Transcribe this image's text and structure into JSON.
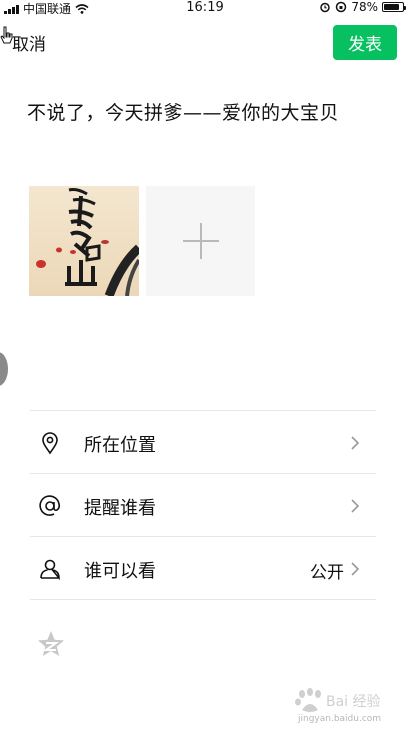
{
  "status_bar": {
    "carrier": "中国联通",
    "time": "16:19",
    "battery": "78%"
  },
  "header": {
    "cancel_label": "取消",
    "publish_label": "发表"
  },
  "post": {
    "text": "不说了，今天拼爹——爱你的大宝贝"
  },
  "options": [
    {
      "label": "所在位置",
      "value": ""
    },
    {
      "label": "提醒谁看",
      "value": ""
    },
    {
      "label": "谁可以看",
      "value": "公开"
    }
  ],
  "watermark": {
    "text": "jingyan.baidu.com"
  },
  "colors": {
    "accent": "#07c160",
    "divider": "#e6e6e6"
  }
}
